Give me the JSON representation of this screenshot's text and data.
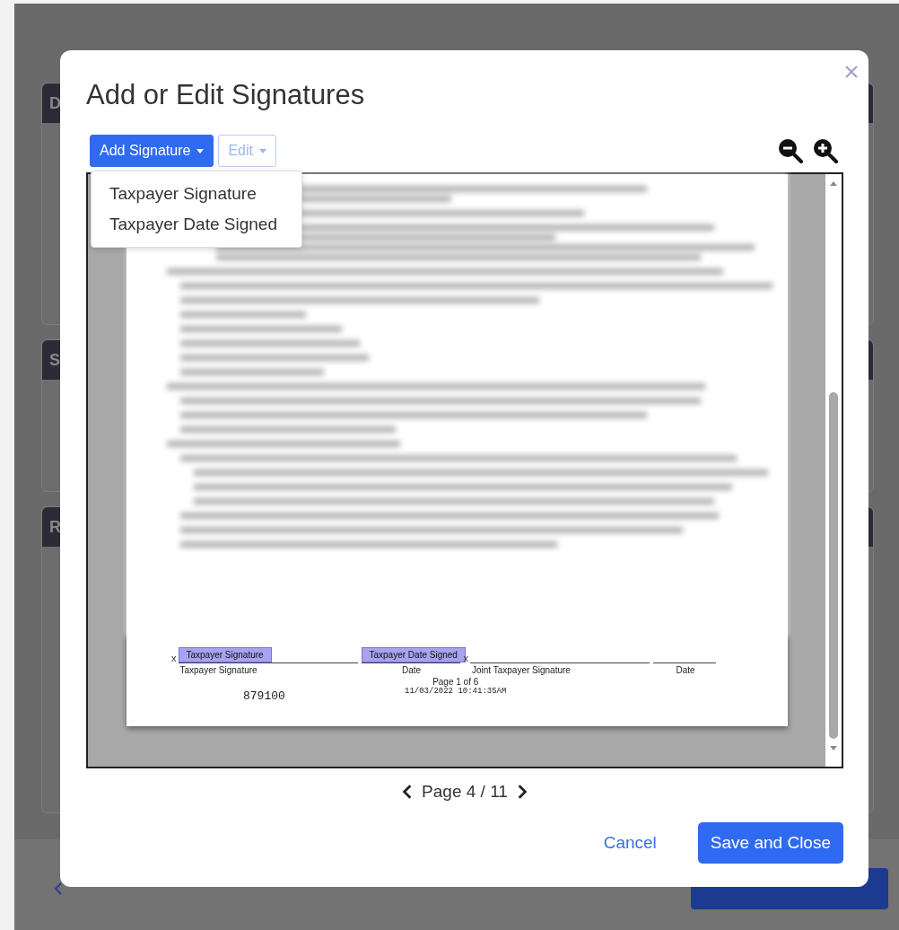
{
  "background_page": {
    "cards": [
      {
        "label": "D"
      },
      {
        "label": "S"
      },
      {
        "label": "R"
      }
    ]
  },
  "dialog": {
    "title": "Add or Edit Signatures",
    "toolbar": {
      "add_button": {
        "label": "Add Signature",
        "disabled": false
      },
      "edit_button": {
        "label": "Edit",
        "disabled": true
      }
    },
    "menu": [
      {
        "label": "Taxpayer Signature"
      },
      {
        "label": "Taxpayer Date Signed"
      }
    ],
    "document": {
      "signature_fields": [
        {
          "mark": "x",
          "tag": "Taxpayer Signature",
          "caption": "Taxpayer Signature"
        },
        {
          "tag": "Taxpayer Date Signed",
          "caption": "Date"
        },
        {
          "mark": "x",
          "caption": "Joint Taxpayer Signature"
        },
        {
          "caption": "Date"
        }
      ],
      "number": "879100",
      "page_label": "Page 1 of 6",
      "timestamp": "11/03/2022 10:41:35AM"
    },
    "pager": {
      "label": "Page 4 / 11"
    },
    "buttons": {
      "cancel": "Cancel",
      "save": "Save and Close"
    }
  }
}
